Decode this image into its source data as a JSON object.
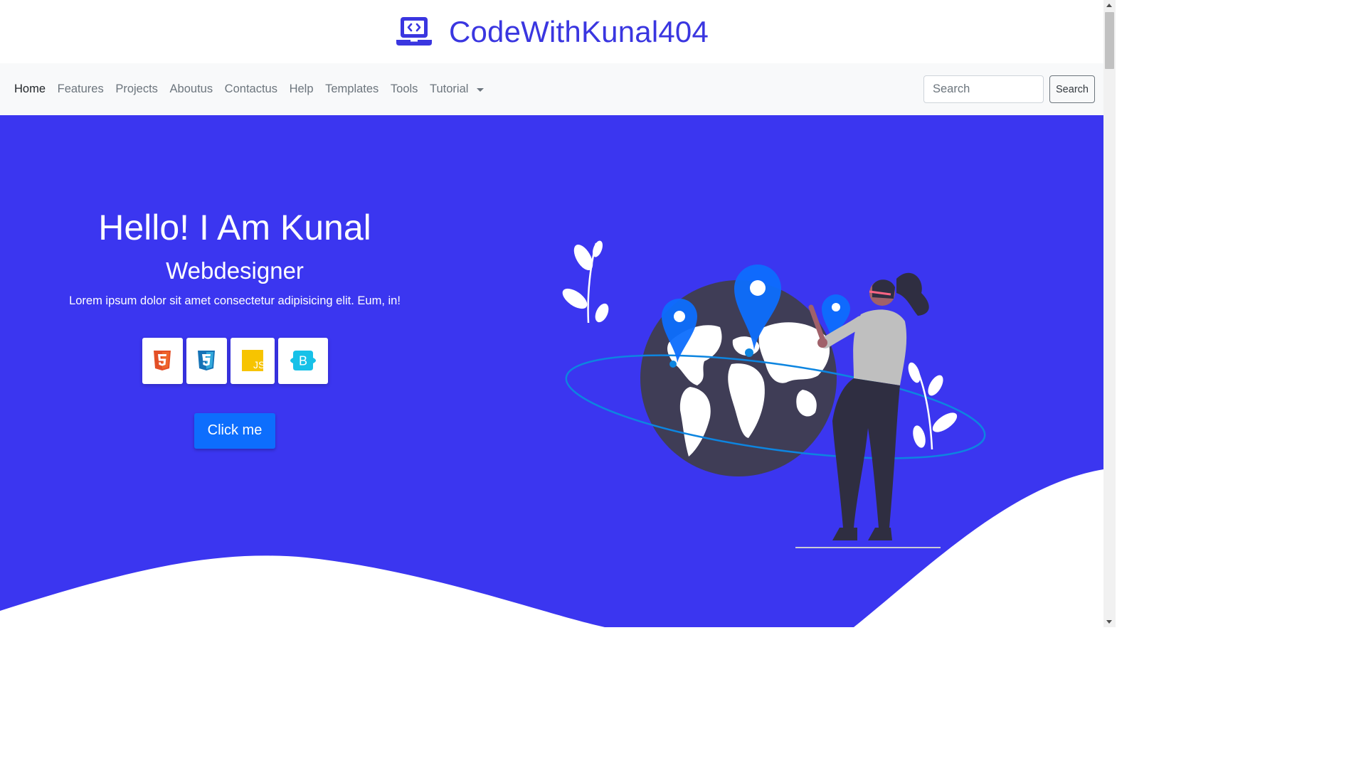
{
  "brand": {
    "title": "CodeWithKunal404",
    "icon": "laptop-code-icon",
    "color": "#3a36e0"
  },
  "nav": {
    "items": [
      {
        "label": "Home",
        "active": true
      },
      {
        "label": "Features"
      },
      {
        "label": "Projects"
      },
      {
        "label": "Aboutus"
      },
      {
        "label": "Contactus"
      },
      {
        "label": "Help"
      },
      {
        "label": "Templates"
      },
      {
        "label": "Tools"
      }
    ],
    "dropdown_label": "Tutorial",
    "search_placeholder": "Search",
    "search_button": "Search"
  },
  "hero": {
    "heading": "Hello! I Am Kunal",
    "subheading": "Webdesigner",
    "text": "Lorem ipsum dolor sit amet consectetur adipisicing elit. Eum, in!",
    "badges": [
      "html5-icon",
      "css3-icon",
      "javascript-icon",
      "bootstrap-icon"
    ],
    "badge_js_text": "JS",
    "badge_bootstrap_text": "B",
    "cta_label": "Click me",
    "background": "#3b36f0",
    "cta_color": "#0d6efd"
  }
}
